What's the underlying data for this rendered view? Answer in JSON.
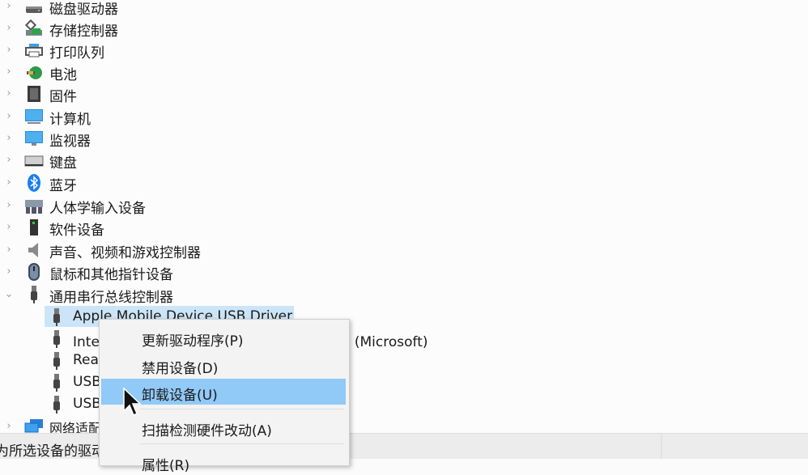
{
  "tree": {
    "categories": [
      {
        "label": "磁盘驱动器",
        "icon": "disk-drive-icon",
        "expanded": false
      },
      {
        "label": "存储控制器",
        "icon": "storage-controller-icon",
        "expanded": false
      },
      {
        "label": "打印队列",
        "icon": "printer-icon",
        "expanded": false
      },
      {
        "label": "电池",
        "icon": "battery-icon",
        "expanded": false
      },
      {
        "label": "固件",
        "icon": "firmware-icon",
        "expanded": false
      },
      {
        "label": "计算机",
        "icon": "computer-icon",
        "expanded": false
      },
      {
        "label": "监视器",
        "icon": "monitor-icon",
        "expanded": false
      },
      {
        "label": "键盘",
        "icon": "keyboard-icon",
        "expanded": false
      },
      {
        "label": "蓝牙",
        "icon": "bluetooth-icon",
        "expanded": false
      },
      {
        "label": "人体学输入设备",
        "icon": "hid-icon",
        "expanded": false
      },
      {
        "label": "软件设备",
        "icon": "software-device-icon",
        "expanded": false
      },
      {
        "label": "声音、视频和游戏控制器",
        "icon": "speaker-icon",
        "expanded": false
      },
      {
        "label": "鼠标和其他指针设备",
        "icon": "mouse-icon",
        "expanded": false
      },
      {
        "label": "通用串行总线控制器",
        "icon": "usb-icon",
        "expanded": true
      },
      {
        "label": "网络适配器",
        "icon": "network-adapter-icon",
        "expanded": false
      }
    ],
    "usb_children": [
      {
        "label": "Apple Mobile Device USB Driver",
        "selected": true
      },
      {
        "label": "Intel(R) USB 3.10 可扩展主机控制器 - 1.20 (Microsoft)",
        "visible_suffix": "Microsoft)"
      },
      {
        "label": "Rea"
      },
      {
        "label": "USB"
      },
      {
        "label": "USB"
      }
    ]
  },
  "context_menu": {
    "items": [
      {
        "label": "更新驱动程序(P)",
        "highlighted": false
      },
      {
        "label": "禁用设备(D)",
        "highlighted": false
      },
      {
        "label": "卸载设备(U)",
        "highlighted": true
      },
      {
        "label": "扫描检测硬件改动(A)",
        "highlighted": false
      },
      {
        "label": "属性(R)",
        "highlighted": false
      }
    ]
  },
  "status_bar": {
    "text": "为所选设备的驱动程序"
  },
  "colors": {
    "selection": "#cce4f7",
    "menu_highlight": "#91c9f7",
    "menu_bg": "#f3f3f3"
  }
}
